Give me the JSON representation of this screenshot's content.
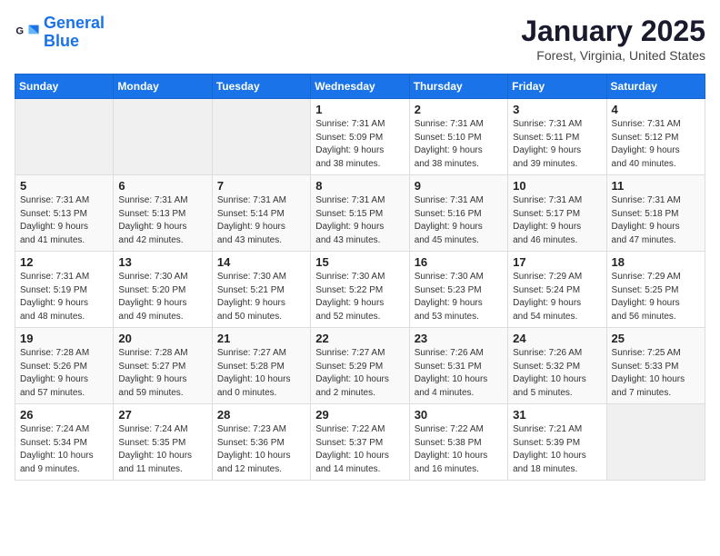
{
  "header": {
    "logo_line1": "General",
    "logo_line2": "Blue",
    "month_title": "January 2025",
    "location": "Forest, Virginia, United States"
  },
  "days_of_week": [
    "Sunday",
    "Monday",
    "Tuesday",
    "Wednesday",
    "Thursday",
    "Friday",
    "Saturday"
  ],
  "weeks": [
    [
      {
        "day": "",
        "info": ""
      },
      {
        "day": "",
        "info": ""
      },
      {
        "day": "",
        "info": ""
      },
      {
        "day": "1",
        "info": "Sunrise: 7:31 AM\nSunset: 5:09 PM\nDaylight: 9 hours\nand 38 minutes."
      },
      {
        "day": "2",
        "info": "Sunrise: 7:31 AM\nSunset: 5:10 PM\nDaylight: 9 hours\nand 38 minutes."
      },
      {
        "day": "3",
        "info": "Sunrise: 7:31 AM\nSunset: 5:11 PM\nDaylight: 9 hours\nand 39 minutes."
      },
      {
        "day": "4",
        "info": "Sunrise: 7:31 AM\nSunset: 5:12 PM\nDaylight: 9 hours\nand 40 minutes."
      }
    ],
    [
      {
        "day": "5",
        "info": "Sunrise: 7:31 AM\nSunset: 5:13 PM\nDaylight: 9 hours\nand 41 minutes."
      },
      {
        "day": "6",
        "info": "Sunrise: 7:31 AM\nSunset: 5:13 PM\nDaylight: 9 hours\nand 42 minutes."
      },
      {
        "day": "7",
        "info": "Sunrise: 7:31 AM\nSunset: 5:14 PM\nDaylight: 9 hours\nand 43 minutes."
      },
      {
        "day": "8",
        "info": "Sunrise: 7:31 AM\nSunset: 5:15 PM\nDaylight: 9 hours\nand 43 minutes."
      },
      {
        "day": "9",
        "info": "Sunrise: 7:31 AM\nSunset: 5:16 PM\nDaylight: 9 hours\nand 45 minutes."
      },
      {
        "day": "10",
        "info": "Sunrise: 7:31 AM\nSunset: 5:17 PM\nDaylight: 9 hours\nand 46 minutes."
      },
      {
        "day": "11",
        "info": "Sunrise: 7:31 AM\nSunset: 5:18 PM\nDaylight: 9 hours\nand 47 minutes."
      }
    ],
    [
      {
        "day": "12",
        "info": "Sunrise: 7:31 AM\nSunset: 5:19 PM\nDaylight: 9 hours\nand 48 minutes."
      },
      {
        "day": "13",
        "info": "Sunrise: 7:30 AM\nSunset: 5:20 PM\nDaylight: 9 hours\nand 49 minutes."
      },
      {
        "day": "14",
        "info": "Sunrise: 7:30 AM\nSunset: 5:21 PM\nDaylight: 9 hours\nand 50 minutes."
      },
      {
        "day": "15",
        "info": "Sunrise: 7:30 AM\nSunset: 5:22 PM\nDaylight: 9 hours\nand 52 minutes."
      },
      {
        "day": "16",
        "info": "Sunrise: 7:30 AM\nSunset: 5:23 PM\nDaylight: 9 hours\nand 53 minutes."
      },
      {
        "day": "17",
        "info": "Sunrise: 7:29 AM\nSunset: 5:24 PM\nDaylight: 9 hours\nand 54 minutes."
      },
      {
        "day": "18",
        "info": "Sunrise: 7:29 AM\nSunset: 5:25 PM\nDaylight: 9 hours\nand 56 minutes."
      }
    ],
    [
      {
        "day": "19",
        "info": "Sunrise: 7:28 AM\nSunset: 5:26 PM\nDaylight: 9 hours\nand 57 minutes."
      },
      {
        "day": "20",
        "info": "Sunrise: 7:28 AM\nSunset: 5:27 PM\nDaylight: 9 hours\nand 59 minutes."
      },
      {
        "day": "21",
        "info": "Sunrise: 7:27 AM\nSunset: 5:28 PM\nDaylight: 10 hours\nand 0 minutes."
      },
      {
        "day": "22",
        "info": "Sunrise: 7:27 AM\nSunset: 5:29 PM\nDaylight: 10 hours\nand 2 minutes."
      },
      {
        "day": "23",
        "info": "Sunrise: 7:26 AM\nSunset: 5:31 PM\nDaylight: 10 hours\nand 4 minutes."
      },
      {
        "day": "24",
        "info": "Sunrise: 7:26 AM\nSunset: 5:32 PM\nDaylight: 10 hours\nand 5 minutes."
      },
      {
        "day": "25",
        "info": "Sunrise: 7:25 AM\nSunset: 5:33 PM\nDaylight: 10 hours\nand 7 minutes."
      }
    ],
    [
      {
        "day": "26",
        "info": "Sunrise: 7:24 AM\nSunset: 5:34 PM\nDaylight: 10 hours\nand 9 minutes."
      },
      {
        "day": "27",
        "info": "Sunrise: 7:24 AM\nSunset: 5:35 PM\nDaylight: 10 hours\nand 11 minutes."
      },
      {
        "day": "28",
        "info": "Sunrise: 7:23 AM\nSunset: 5:36 PM\nDaylight: 10 hours\nand 12 minutes."
      },
      {
        "day": "29",
        "info": "Sunrise: 7:22 AM\nSunset: 5:37 PM\nDaylight: 10 hours\nand 14 minutes."
      },
      {
        "day": "30",
        "info": "Sunrise: 7:22 AM\nSunset: 5:38 PM\nDaylight: 10 hours\nand 16 minutes."
      },
      {
        "day": "31",
        "info": "Sunrise: 7:21 AM\nSunset: 5:39 PM\nDaylight: 10 hours\nand 18 minutes."
      },
      {
        "day": "",
        "info": ""
      }
    ]
  ]
}
